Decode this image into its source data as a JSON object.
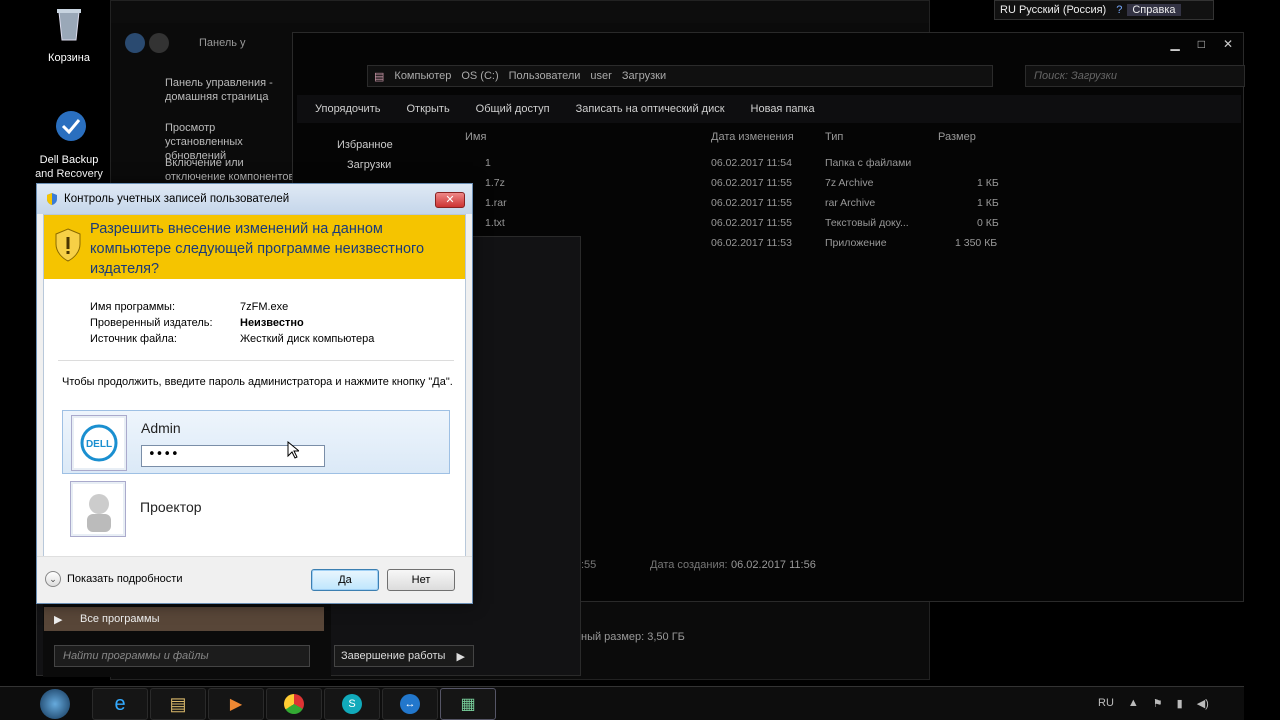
{
  "desktop": {
    "recycle_bin_label": "Корзина",
    "dell_backup_label": "Dell Backup and Recovery"
  },
  "langbar": {
    "language": "RU Русский (Россия)",
    "help": "Справка"
  },
  "control_panel": {
    "address": "Панель у",
    "links": [
      "Панель управления - домашняя страница",
      "Просмотр установленных обновлений",
      "Включение или отключение компонентов Windows"
    ]
  },
  "explorer": {
    "breadcrumb": [
      "Компьютер",
      "OS (C:)",
      "Пользователи",
      "user",
      "Загрузки"
    ],
    "search_placeholder": "Поиск: Загрузки",
    "toolbar": [
      "Упорядочить",
      "Открыть",
      "Общий доступ",
      "Записать на оптический диск",
      "Новая папка"
    ],
    "nav": {
      "favorites": "Избранное",
      "downloads": "Загрузки"
    },
    "columns": {
      "name": "Имя",
      "date": "Дата изменения",
      "type": "Тип",
      "size": "Размер"
    },
    "files": [
      {
        "name": "1",
        "date": "06.02.2017 11:54",
        "type": "Папка с файлами",
        "size": ""
      },
      {
        "name": "1.7z",
        "date": "06.02.2017 11:55",
        "type": "7z Archive",
        "size": "1 КБ"
      },
      {
        "name": "1.rar",
        "date": "06.02.2017 11:55",
        "type": "rar Archive",
        "size": "1 КБ"
      },
      {
        "name": "1.txt",
        "date": "06.02.2017 11:55",
        "type": "Текстовый доку...",
        "size": "0 КБ"
      },
      {
        "name": "",
        "date": "06.02.2017 11:53",
        "type": "Приложение",
        "size": "1 350 КБ"
      }
    ],
    "status_time": ":55",
    "status_created_label": "Дата создания:",
    "status_created_value": "06.02.2017 11:56",
    "status_size": "ный размер: 3,50 ГБ"
  },
  "start_menu": {
    "all_programs": "Все программы",
    "search_placeholder": "Найти программы и файлы",
    "shutdown": "Завершение работы"
  },
  "uac": {
    "title": "Контроль учетных записей пользователей",
    "question": "Разрешить внесение изменений на данном компьютере следующей программе неизвестного издателя?",
    "program_label": "Имя программы:",
    "program_value": "7zFM.exe",
    "publisher_label": "Проверенный издатель:",
    "publisher_value": "Неизвестно",
    "source_label": "Источник файла:",
    "source_value": "Жесткий диск компьютера",
    "prompt": "Чтобы продолжить, введите пароль администратора и нажмите кнопку \"Да\".",
    "user1_name": "Admin",
    "password_value": "••••",
    "user2_name": "Проектор",
    "dell_logo": "DELL",
    "details": "Показать подробности",
    "yes": "Да",
    "no": "Нет"
  },
  "taskbar": {
    "tray_lang": "RU"
  }
}
